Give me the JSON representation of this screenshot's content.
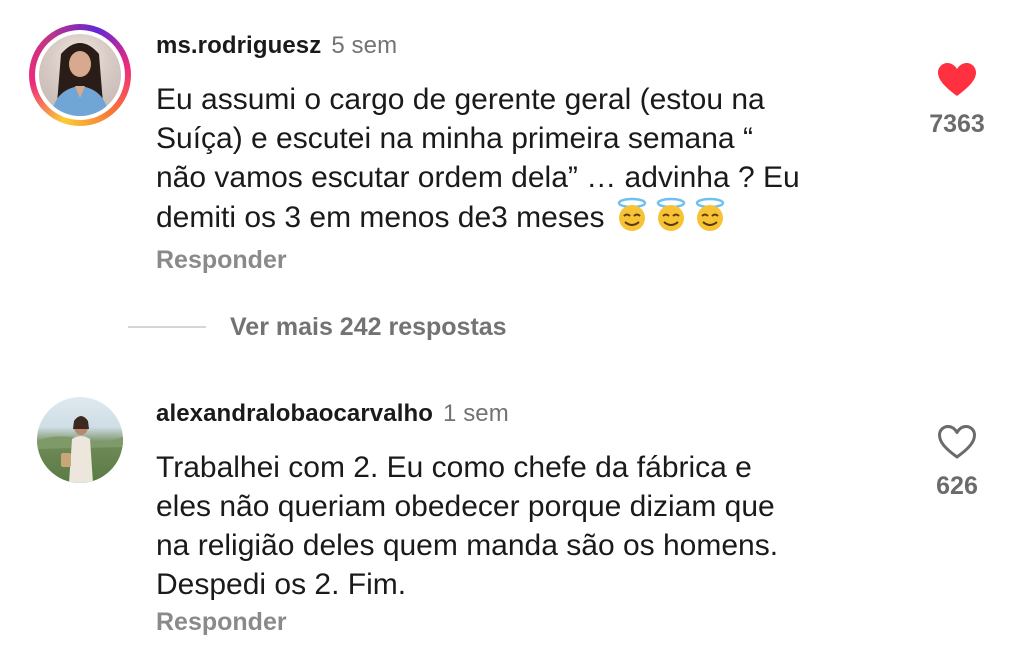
{
  "comments": [
    {
      "username": "ms.rodriguesz",
      "time": "5 sem",
      "text": "Eu assumi o cargo de gerente geral (estou na\nSuíça) e escutei na minha primeira semana “\nnão vamos escutar ordem dela” … advinha ? Eu\ndemiti os 3 em menos de3 meses",
      "emoji": "😇😇😇",
      "reply_label": "Responder",
      "likes": "7363",
      "liked": true,
      "like_color": "#ff3040"
    },
    {
      "username": "alexandralobaocarvalho",
      "time": "1 sem",
      "text": "Trabalhei com 2. Eu como chefe da fábrica e\neles não queriam obedecer porque diziam que\nna religião deles quem manda são os homens.\nDespedi os 2. Fim.",
      "reply_label": "Responder",
      "likes": "626",
      "liked": false
    }
  ],
  "more_replies": {
    "label": "Ver mais 242 respostas"
  },
  "icons": {
    "liked_heart": "heart-filled-icon",
    "unliked_heart": "heart-outline-icon",
    "emoji": "smiling-face-with-halo"
  }
}
